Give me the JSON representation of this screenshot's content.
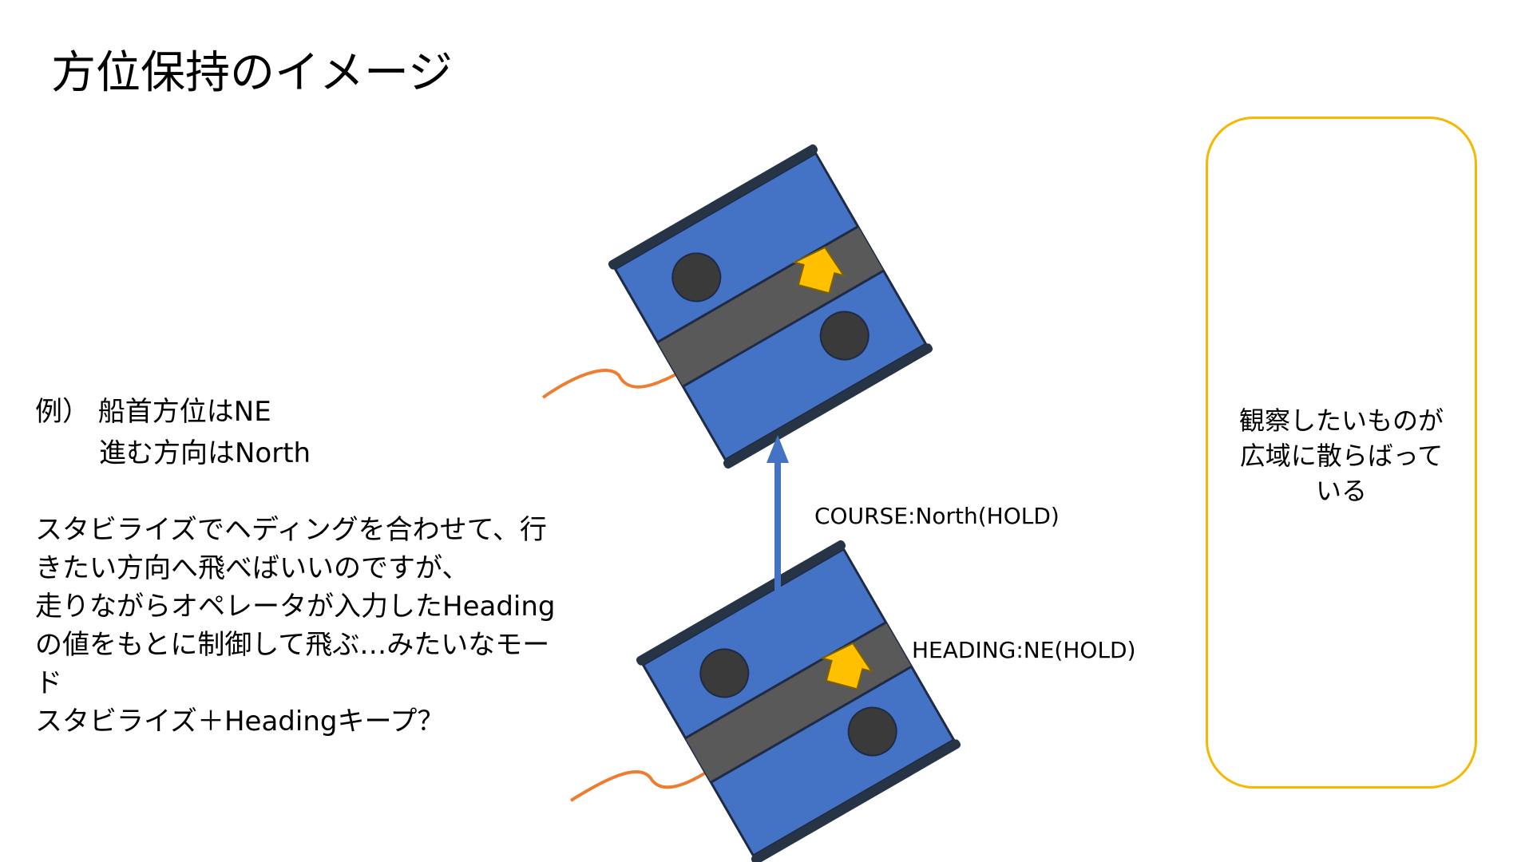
{
  "title": "方位保持のイメージ",
  "example": {
    "line1": "例） 船首方位はNE",
    "line2": "進む方向はNorth"
  },
  "description": [
    "スタビライズでヘディングを合わせて、行",
    "きたい方向へ飛べばいいのですが、",
    "走りながらオペレータが入力したHeading",
    "の値をもとに制御して飛ぶ…みたいなモー",
    "ド",
    "スタビライズ＋Headingキープ？"
  ],
  "labels": {
    "course": "COURSE:North(HOLD)",
    "heading": "HEADING:NE(HOLD)"
  },
  "observation": {
    "lines": [
      "観察したいものが",
      "広域に散らばって",
      "いる"
    ]
  },
  "colors": {
    "arrow": "#4472c4",
    "boat_hull": "#4472c4",
    "boat_stripe": "#595959",
    "boat_edge": "#1f2a44",
    "heading_arrow": "#ffc000",
    "tether": "#ed7d31",
    "observation_border": "#f4b800"
  }
}
